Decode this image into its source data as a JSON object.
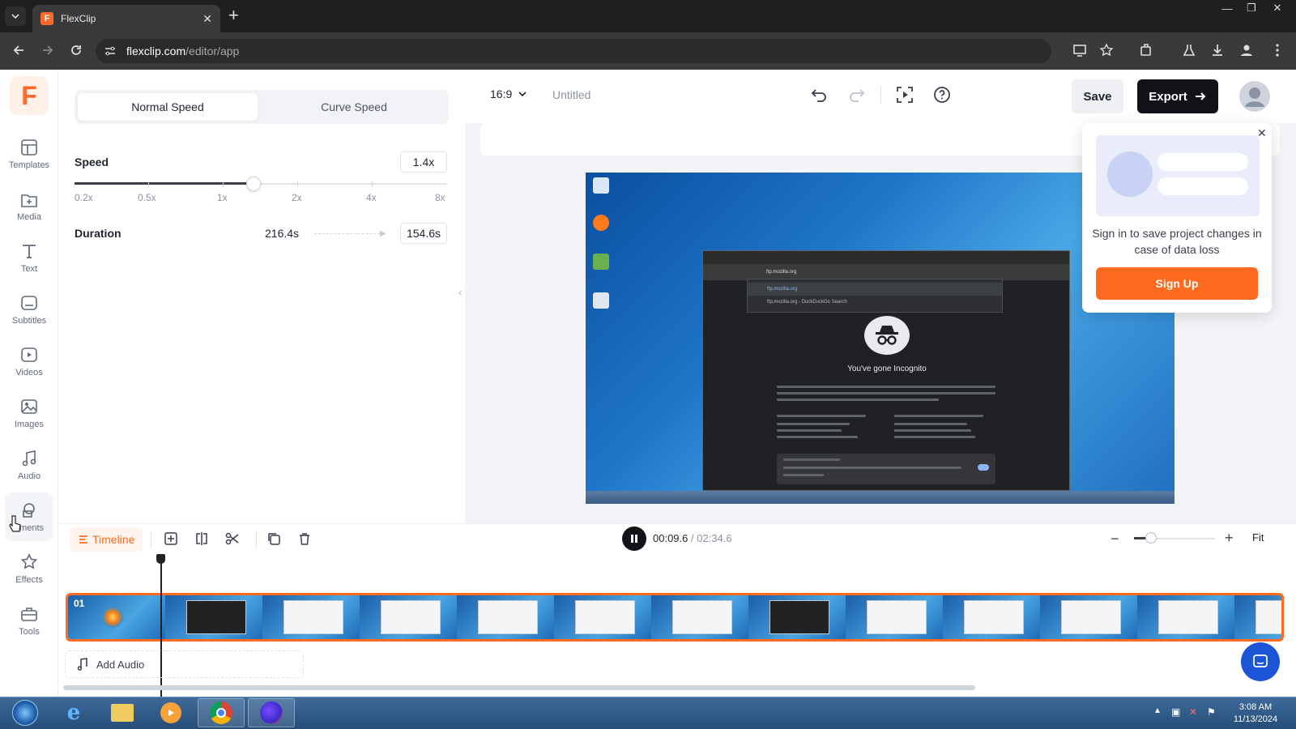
{
  "browser": {
    "tab_title": "FlexClip",
    "tab_icon": "F",
    "url_host": "flexclip.com",
    "url_path": "/editor/app"
  },
  "sidebar": {
    "logo": "F",
    "items": [
      {
        "label": "Templates",
        "icon": "templates-icon"
      },
      {
        "label": "Media",
        "icon": "media-icon"
      },
      {
        "label": "Text",
        "icon": "text-icon"
      },
      {
        "label": "Subtitles",
        "icon": "subtitles-icon"
      },
      {
        "label": "Videos",
        "icon": "videos-icon"
      },
      {
        "label": "Images",
        "icon": "images-icon"
      },
      {
        "label": "Audio",
        "icon": "audio-icon"
      },
      {
        "label": "ements",
        "icon": "elements-icon"
      },
      {
        "label": "Effects",
        "icon": "effects-icon"
      },
      {
        "label": "Tools",
        "icon": "tools-icon"
      }
    ]
  },
  "speed_panel": {
    "tabs": [
      "Normal Speed",
      "Curve Speed"
    ],
    "active_tab": "Normal Speed",
    "speed_label": "Speed",
    "speed_value": "1.4x",
    "ticks": [
      "0.2x",
      "0.5x",
      "1x",
      "2x",
      "4x",
      "8x"
    ],
    "duration_label": "Duration",
    "duration_original": "216.4s",
    "duration_new": "154.6s"
  },
  "toolbar": {
    "ratio": "16:9",
    "title": "Untitled",
    "save_label": "Save",
    "export_label": "Export"
  },
  "preview": {
    "incognito_title": "You've gone Incognito",
    "address_text": "ftp.mozilla.org",
    "suggestion_1": "ftp.mozilla.org",
    "suggestion_2": "ftp.mozilla.org - DuckDuckGo Search"
  },
  "signin_popup": {
    "message": "Sign in to save project changes in case of data loss",
    "button": "Sign Up"
  },
  "timeline": {
    "label": "Timeline",
    "current_time": "00:09.6",
    "total_time": "02:34.6",
    "fit_label": "Fit",
    "track_number": "01",
    "add_audio": "Add Audio"
  },
  "taskbar": {
    "time": "3:08 AM",
    "date": "11/13/2024"
  },
  "colors": {
    "accent": "#ff6a1e",
    "export_bg": "#111318",
    "chat": "#1c55d8"
  }
}
